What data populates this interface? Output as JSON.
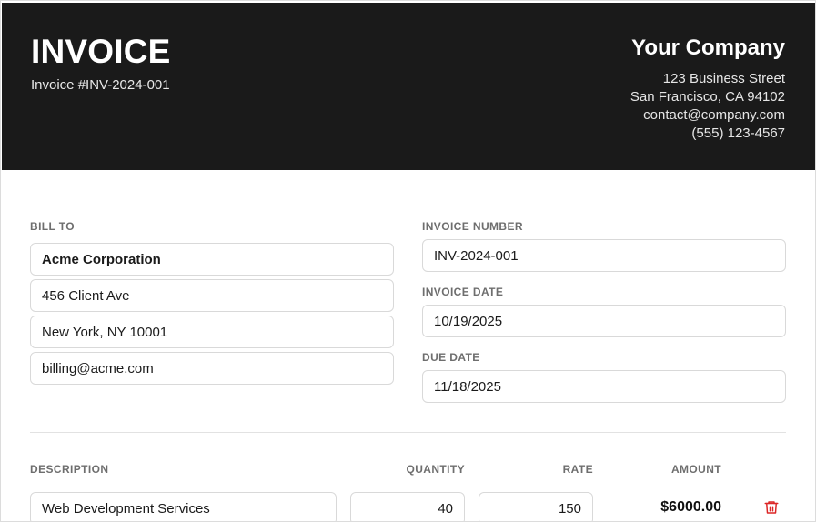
{
  "header": {
    "title": "INVOICE",
    "invoice_number_text": "Invoice #INV-2024-001",
    "company": {
      "name": "Your Company",
      "address_line1": "123 Business Street",
      "address_line2": "San Francisco, CA 94102",
      "email": "contact@company.com",
      "phone": "(555) 123-4567"
    }
  },
  "bill_to": {
    "label": "BILL TO",
    "name": "Acme Corporation",
    "street": "456 Client Ave",
    "city": "New York, NY 10001",
    "email": "billing@acme.com"
  },
  "invoice_meta": {
    "number_label": "INVOICE NUMBER",
    "number_value": "INV-2024-001",
    "date_label": "INVOICE DATE",
    "date_value": "10/19/2025",
    "due_label": "DUE DATE",
    "due_value": "11/18/2025"
  },
  "items": {
    "columns": {
      "description": "DESCRIPTION",
      "quantity": "QUANTITY",
      "rate": "RATE",
      "amount": "AMOUNT"
    },
    "rows": [
      {
        "description": "Web Development Services",
        "quantity": "40",
        "rate": "150",
        "amount": "$6000.00",
        "delete_icon": "trash-icon"
      }
    ]
  },
  "colors": {
    "header_bg": "#1a1a1a",
    "delete_red": "#dc2626"
  }
}
